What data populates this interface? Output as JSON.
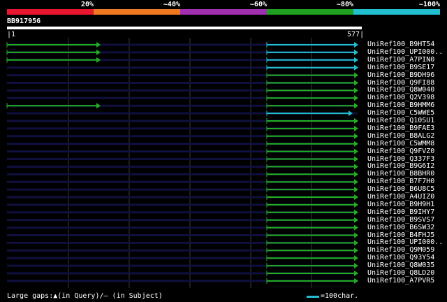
{
  "legend": {
    "colors": [
      "#e8162e",
      "#f07820",
      "#a030b0",
      "#20a020",
      "#20c0d0"
    ],
    "labels": [
      "20%",
      "~40%",
      "~60%",
      "~80%",
      "~100%"
    ]
  },
  "query": {
    "id": "BB917956",
    "start": "1",
    "end": "577",
    "length": 577
  },
  "hits": [
    {
      "name": "UniRef100_B9HT54",
      "bar": "cyan",
      "q_start": 0.741,
      "q_end": 1.0,
      "extra": [
        [
          0.0,
          0.265
        ]
      ]
    },
    {
      "name": "UniRef100_UPI000..",
      "bar": "cyan",
      "q_start": 0.741,
      "q_end": 1.0,
      "extra": [
        [
          0.0,
          0.265
        ]
      ]
    },
    {
      "name": "UniRef100_A7PIN0",
      "bar": "cyan",
      "q_start": 0.741,
      "q_end": 1.0,
      "extra": [
        [
          0.0,
          0.265
        ]
      ]
    },
    {
      "name": "UniRef100_B9SE17",
      "bar": "cyan",
      "q_start": 0.741,
      "q_end": 1.0,
      "extra": []
    },
    {
      "name": "UniRef100_B9DH96",
      "bar": "green",
      "q_start": 0.741,
      "q_end": 1.0,
      "extra": []
    },
    {
      "name": "UniRef100_Q9FI88",
      "bar": "green",
      "q_start": 0.741,
      "q_end": 1.0,
      "extra": []
    },
    {
      "name": "UniRef100_Q8W040",
      "bar": "green",
      "q_start": 0.741,
      "q_end": 1.0,
      "extra": []
    },
    {
      "name": "UniRef100_Q2V398",
      "bar": "green",
      "q_start": 0.741,
      "q_end": 1.0,
      "extra": []
    },
    {
      "name": "UniRef100_B9HMM6",
      "bar": "green",
      "q_start": 0.741,
      "q_end": 1.0,
      "extra": [
        [
          0.0,
          0.265
        ]
      ]
    },
    {
      "name": "UniRef100_C5WWE5",
      "bar": "cyan",
      "q_start": 0.741,
      "q_end": 0.984,
      "extra": []
    },
    {
      "name": "UniRef100_Q10SU1",
      "bar": "green",
      "q_start": 0.741,
      "q_end": 1.0,
      "extra": []
    },
    {
      "name": "UniRef100_B9FAE3",
      "bar": "green",
      "q_start": 0.741,
      "q_end": 1.0,
      "extra": []
    },
    {
      "name": "UniRef100_B8ALG2",
      "bar": "green",
      "q_start": 0.741,
      "q_end": 1.0,
      "extra": []
    },
    {
      "name": "UniRef100_C5WMM8",
      "bar": "green",
      "q_start": 0.741,
      "q_end": 1.0,
      "extra": []
    },
    {
      "name": "UniRef100_Q9FVZ0",
      "bar": "green",
      "q_start": 0.741,
      "q_end": 1.0,
      "extra": []
    },
    {
      "name": "UniRef100_Q337F3",
      "bar": "green",
      "q_start": 0.741,
      "q_end": 1.0,
      "extra": []
    },
    {
      "name": "UniRef100_B9G6I2",
      "bar": "green",
      "q_start": 0.741,
      "q_end": 1.0,
      "extra": []
    },
    {
      "name": "UniRef100_B8BHR0",
      "bar": "green",
      "q_start": 0.741,
      "q_end": 1.0,
      "extra": []
    },
    {
      "name": "UniRef100_B7F7H0",
      "bar": "green",
      "q_start": 0.741,
      "q_end": 1.0,
      "extra": []
    },
    {
      "name": "UniRef100_B6U8C5",
      "bar": "green",
      "q_start": 0.741,
      "q_end": 1.0,
      "extra": []
    },
    {
      "name": "UniRef100_A4UIZ0",
      "bar": "green",
      "q_start": 0.741,
      "q_end": 1.0,
      "extra": []
    },
    {
      "name": "UniRef100_B9H9H1",
      "bar": "green",
      "q_start": 0.741,
      "q_end": 1.0,
      "extra": []
    },
    {
      "name": "UniRef100_B9IHY7",
      "bar": "green",
      "q_start": 0.741,
      "q_end": 1.0,
      "extra": []
    },
    {
      "name": "UniRef100_B9SVS7",
      "bar": "green",
      "q_start": 0.741,
      "q_end": 1.0,
      "extra": []
    },
    {
      "name": "UniRef100_B6SW32",
      "bar": "green",
      "q_start": 0.741,
      "q_end": 1.0,
      "extra": []
    },
    {
      "name": "UniRef100_B4FHJ5",
      "bar": "green",
      "q_start": 0.741,
      "q_end": 1.0,
      "extra": []
    },
    {
      "name": "UniRef100_UPI000..",
      "bar": "green",
      "q_start": 0.741,
      "q_end": 1.0,
      "extra": []
    },
    {
      "name": "UniRef100_Q9M059",
      "bar": "green",
      "q_start": 0.741,
      "q_end": 1.0,
      "extra": []
    },
    {
      "name": "UniRef100_Q93Y54",
      "bar": "green",
      "q_start": 0.741,
      "q_end": 1.0,
      "extra": []
    },
    {
      "name": "UniRef100_Q8W035",
      "bar": "green",
      "q_start": 0.741,
      "q_end": 1.0,
      "extra": []
    },
    {
      "name": "UniRef100_Q8LD20",
      "bar": "green",
      "q_start": 0.741,
      "q_end": 1.0,
      "extra": []
    },
    {
      "name": "UniRef100_A7PVR5",
      "bar": "green",
      "q_start": 0.741,
      "q_end": 1.0,
      "extra": []
    }
  ],
  "colors": {
    "cyan": "#20c0d0",
    "green": "#20b020",
    "track": "#101040",
    "grid": "#3a3a3a"
  },
  "footer": {
    "gaps_label": "Large gaps:",
    "gaps_query_glyph": "▲",
    "gaps_query_text": "(in Query)/",
    "gaps_subject_glyph": "–",
    "gaps_subject_text": " (in Subject)",
    "scale_label": "=100char."
  }
}
